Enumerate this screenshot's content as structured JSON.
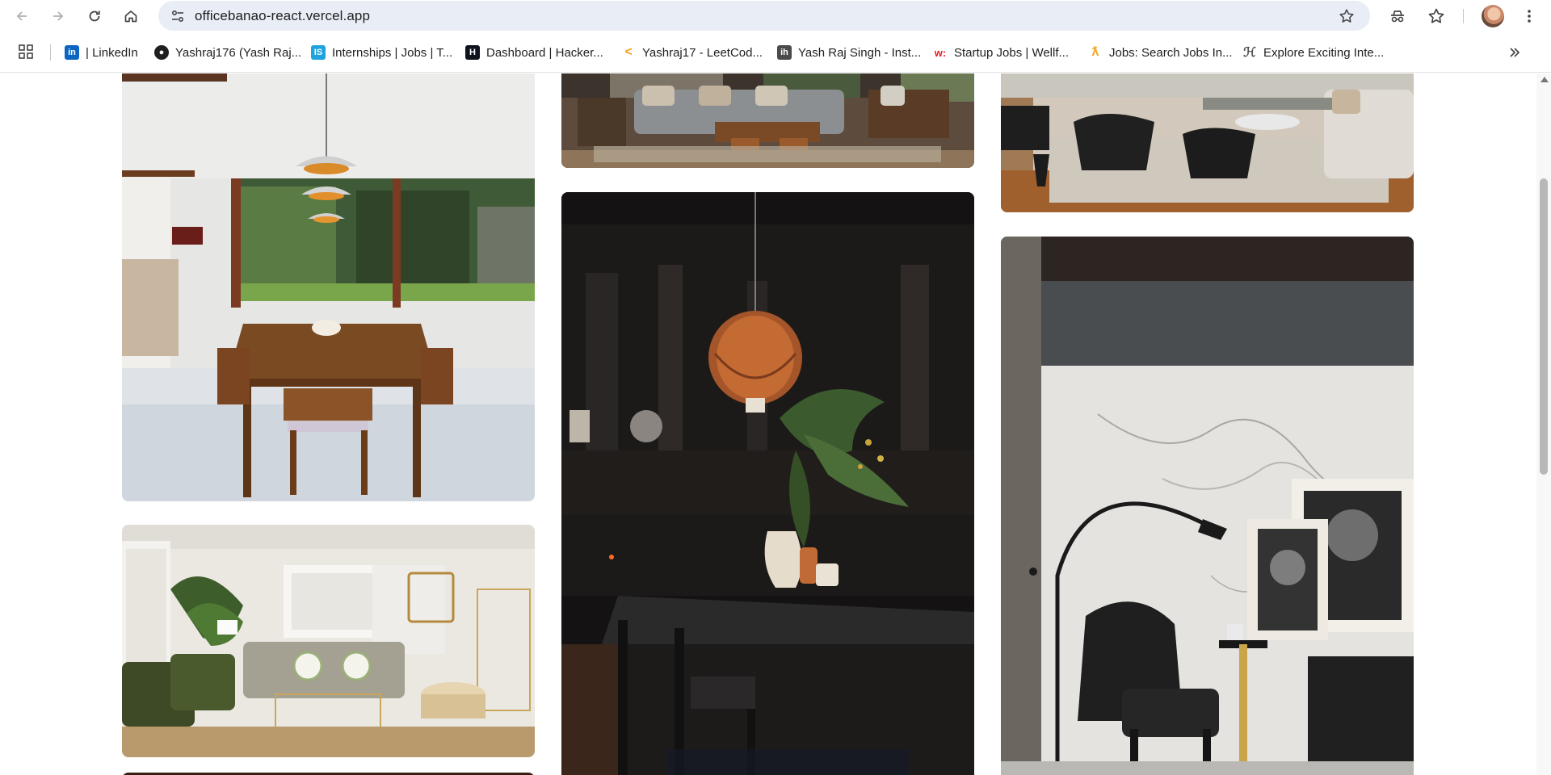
{
  "browser": {
    "url": "officebanao-react.vercel.app",
    "bookmarks": [
      {
        "label": "| LinkedIn",
        "icon": "linkedin-icon",
        "color": "#0a66c2"
      },
      {
        "label": "Yashraj176 (Yash Raj...",
        "icon": "github-icon",
        "color": "#1f1f1f"
      },
      {
        "label": "Internships | Jobs | T...",
        "icon": "internshala-icon",
        "color": "#1ea3e0"
      },
      {
        "label": "Dashboard | Hacker...",
        "icon": "hackerrank-icon",
        "color": "#0e141e"
      },
      {
        "label": "Yashraj17 - LeetCod...",
        "icon": "leetcode-icon",
        "color": "#f89f1b"
      },
      {
        "label": "Yash Raj Singh - Inst...",
        "icon": "instahyre-icon",
        "color": "#4a4a4a"
      },
      {
        "label": "Startup Jobs | Wellf...",
        "icon": "wellfound-icon",
        "color": "#ec1c24"
      },
      {
        "label": "Jobs: Search Jobs In...",
        "icon": "jobs-search-icon",
        "color": "#f5a623"
      },
      {
        "label": "Explore Exciting Inte...",
        "icon": "explore-internships-icon",
        "color": "#555555"
      }
    ]
  },
  "gallery": {
    "images": [
      {
        "scene": "dining-room-garden-view"
      },
      {
        "scene": "living-room-sofa-strip"
      },
      {
        "scene": "open-lounge-black-armchairs"
      },
      {
        "scene": "green-armchair-living-room"
      },
      {
        "scene": "dark-kitchen-pendant-lamp"
      },
      {
        "scene": "marble-wall-lounge-floor-lamp"
      },
      {
        "scene": "partial-card"
      }
    ]
  }
}
